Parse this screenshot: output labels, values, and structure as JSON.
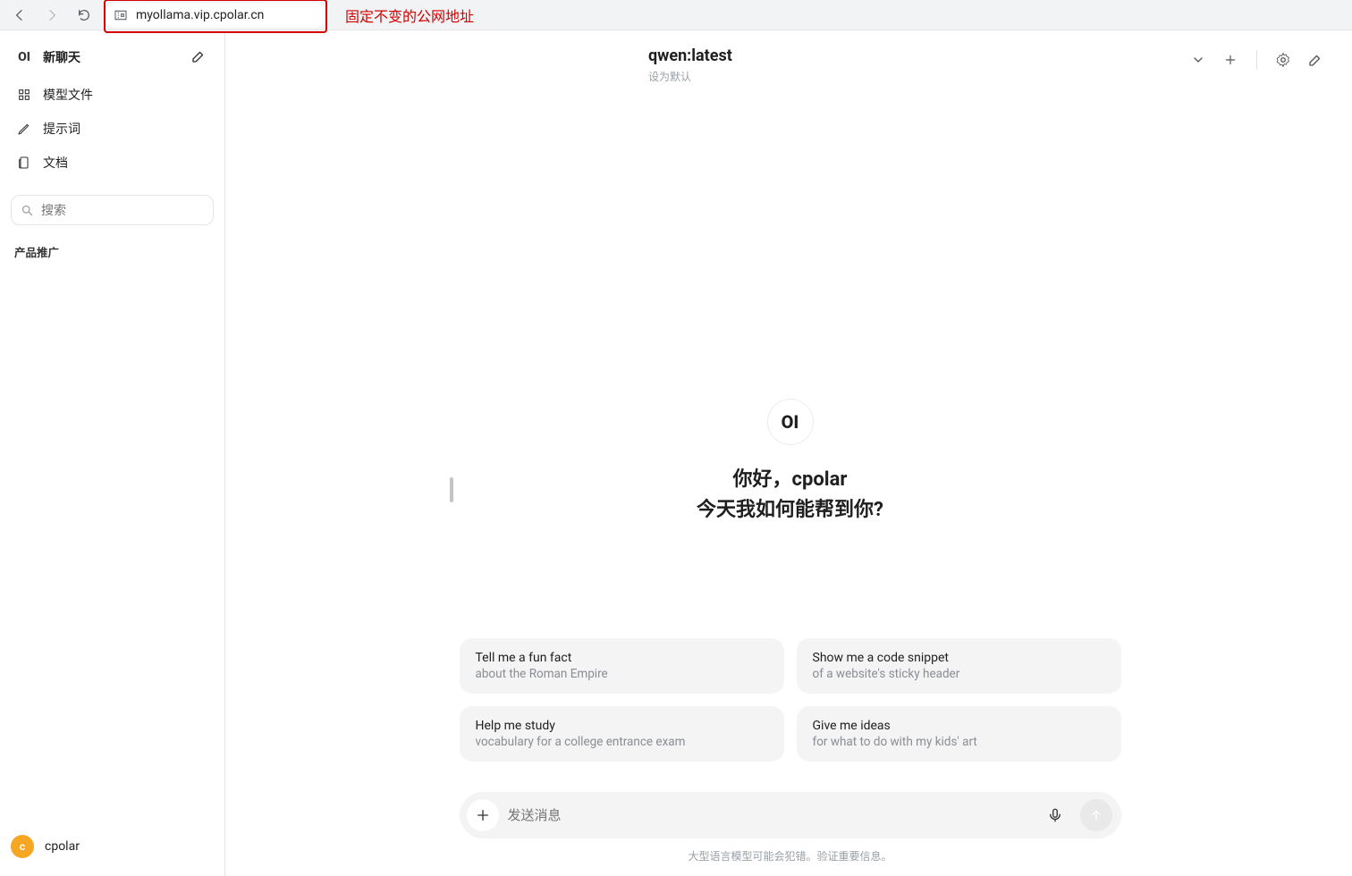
{
  "browser": {
    "url": "myollama.vip.cpolar.cn"
  },
  "annotation": {
    "label": "固定不变的公网地址"
  },
  "sidebar": {
    "newchat_label": "新聊天",
    "items": [
      {
        "icon": "grid",
        "label": "模型文件"
      },
      {
        "icon": "pen",
        "label": "提示词"
      },
      {
        "icon": "docs",
        "label": "文档"
      }
    ],
    "search_placeholder": "搜索",
    "section_heading": "产品推广",
    "user": {
      "initial": "c",
      "name": "cpolar"
    }
  },
  "header": {
    "model": "qwen:latest",
    "set_default": "设为默认"
  },
  "hero": {
    "logo": "OI",
    "line1": "你好，cpolar",
    "line2": "今天我如何能帮到你?"
  },
  "suggestions": [
    {
      "title": "Tell me a fun fact",
      "subtitle": "about the Roman Empire"
    },
    {
      "title": "Show me a code snippet",
      "subtitle": "of a website's sticky header"
    },
    {
      "title": "Help me study",
      "subtitle": "vocabulary for a college entrance exam"
    },
    {
      "title": "Give me ideas",
      "subtitle": "for what to do with my kids' art"
    }
  ],
  "composer": {
    "placeholder": "发送消息"
  },
  "footer": {
    "disclaimer": "大型语言模型可能会犯错。验证重要信息。"
  }
}
